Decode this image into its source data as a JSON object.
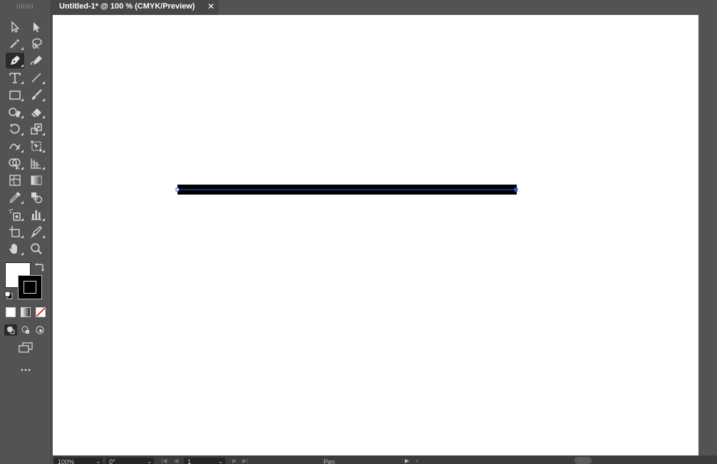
{
  "document_tab": {
    "title": "Untitled-1* @ 100 % (CMYK/Preview)",
    "close_glyph": "✕"
  },
  "toolbar": {
    "tools": [
      {
        "name": "selection-tool-icon",
        "active": false
      },
      {
        "name": "direct-selection-tool-icon",
        "active": false
      },
      {
        "name": "magic-wand-tool-icon",
        "active": false
      },
      {
        "name": "lasso-tool-icon",
        "active": false
      },
      {
        "name": "pen-tool-icon",
        "active": true
      },
      {
        "name": "curvature-tool-icon",
        "active": false
      },
      {
        "name": "type-tool-icon",
        "active": false
      },
      {
        "name": "line-segment-tool-icon",
        "active": false
      },
      {
        "name": "rectangle-tool-icon",
        "active": false
      },
      {
        "name": "paintbrush-tool-icon",
        "active": false
      },
      {
        "name": "shaper-tool-icon",
        "active": false
      },
      {
        "name": "eraser-tool-icon",
        "active": false
      },
      {
        "name": "rotate-tool-icon",
        "active": false
      },
      {
        "name": "scale-tool-icon",
        "active": false
      },
      {
        "name": "warp-tool-icon",
        "active": false
      },
      {
        "name": "free-transform-tool-icon",
        "active": false
      },
      {
        "name": "shape-builder-tool-icon",
        "active": false
      },
      {
        "name": "perspective-grid-tool-icon",
        "active": false
      },
      {
        "name": "mesh-tool-icon",
        "active": false
      },
      {
        "name": "gradient-tool-icon",
        "active": false
      },
      {
        "name": "eyedropper-tool-icon",
        "active": false
      },
      {
        "name": "blend-tool-icon",
        "active": false
      },
      {
        "name": "symbol-sprayer-tool-icon",
        "active": false
      },
      {
        "name": "column-graph-tool-icon",
        "active": false
      },
      {
        "name": "artboard-tool-icon",
        "active": false
      },
      {
        "name": "slice-tool-icon",
        "active": false
      },
      {
        "name": "hand-tool-icon",
        "active": false
      },
      {
        "name": "zoom-tool-icon",
        "active": false
      }
    ],
    "fill_color": "#ffffff",
    "stroke_color": "#000000",
    "more_tools_glyph": "•••"
  },
  "canvas": {
    "background": "#ffffff",
    "path_stroke_color": "#000000",
    "selection_color": "#3b5bdb"
  },
  "status_bar": {
    "zoom": "100%",
    "rotation": "0°",
    "artboard": "1",
    "current_tool": "Pen",
    "dropdown_glyph": "⌄"
  }
}
